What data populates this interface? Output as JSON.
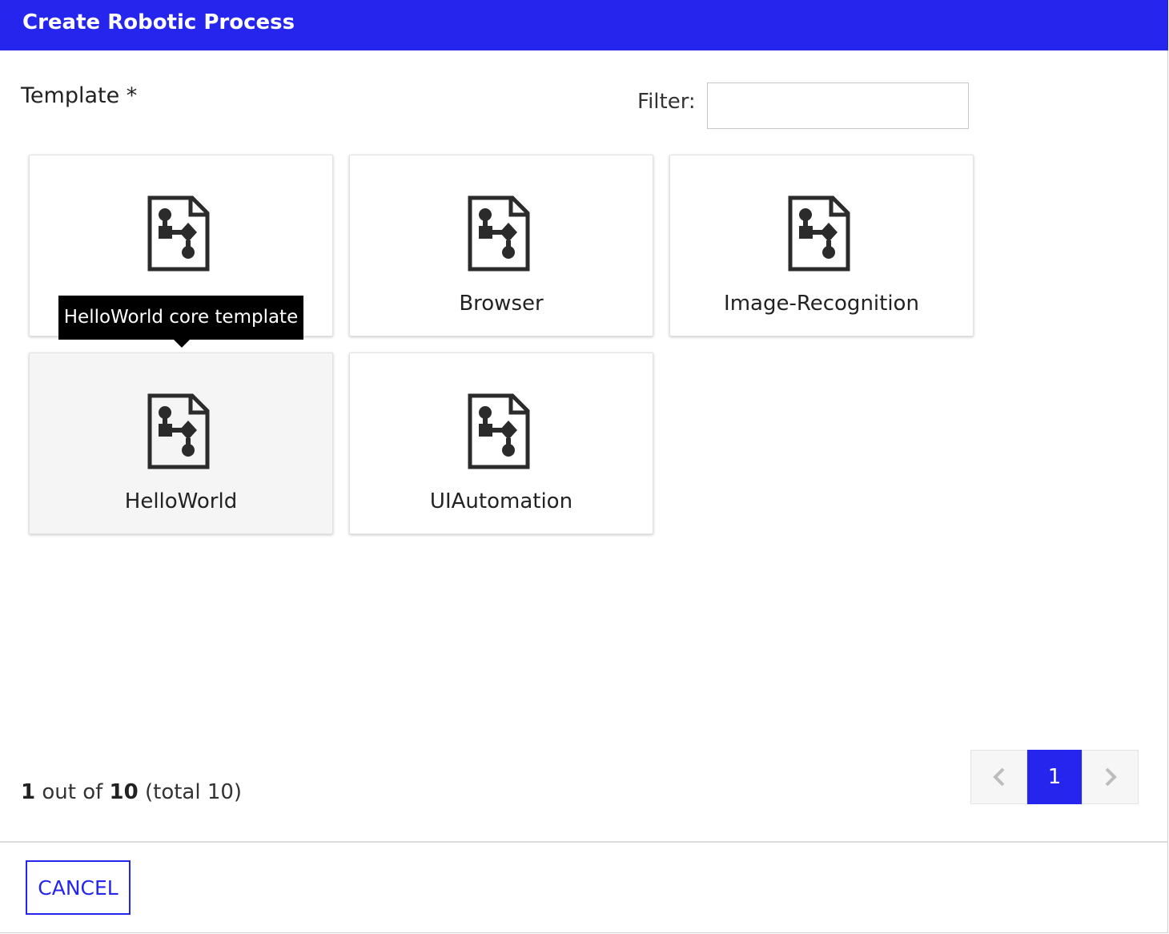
{
  "dialog": {
    "title": "Create Robotic Process"
  },
  "template_field": {
    "label": "Template *"
  },
  "filter": {
    "label": "Filter:",
    "value": "",
    "placeholder": ""
  },
  "templates": [
    {
      "label": "",
      "icon": "process-document-icon"
    },
    {
      "label": "Browser",
      "icon": "process-document-icon"
    },
    {
      "label": "Image-Recognition",
      "icon": "process-document-icon"
    },
    {
      "label": "HelloWorld",
      "icon": "process-document-icon"
    },
    {
      "label": "UIAutomation",
      "icon": "process-document-icon"
    }
  ],
  "tooltip": {
    "text": "HelloWorld core template"
  },
  "pagination": {
    "current": "1",
    "out_of_text": "out of",
    "pages": "10",
    "total_text": "(total 10)",
    "active_page_label": "1",
    "prev_icon": "chevron-left-icon",
    "next_icon": "chevron-right-icon"
  },
  "footer": {
    "cancel_label": "CANCEL"
  },
  "colors": {
    "accent": "#2525ee",
    "tooltip_bg": "#000000",
    "hover_card_bg": "#f5f5f5"
  }
}
